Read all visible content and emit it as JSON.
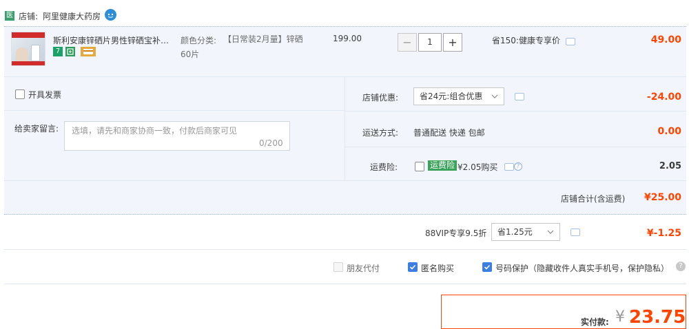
{
  "shop": {
    "badge": "医",
    "prefix": "店铺:",
    "name": "阿里健康大药房",
    "chat_icon": "wangwang-chat-icon"
  },
  "item": {
    "title": "斯利安康锌硒片男性锌硒宝补锌...",
    "tags": [
      "7",
      "credit-badge-icon",
      "wallet-card-icon"
    ],
    "sku_label": "颜色分类:",
    "sku_value_line1": "【日常装2月量】锌硒",
    "sku_value_line2": "60片",
    "unit_price": "199.00",
    "qty_minus": "−",
    "quantity": "1",
    "qty_plus": "+",
    "promo": "省150:健康专享价",
    "subtotal": "49.00"
  },
  "invoice": {
    "label": "开具发票"
  },
  "remark": {
    "label": "给卖家留言:",
    "placeholder": "选填，请先和商家协商一致，付款后商家可见",
    "counter": "0/200"
  },
  "discount": {
    "label": "店铺优惠:",
    "selected": "省24元:组合优惠",
    "amount": "-24.00"
  },
  "shipping": {
    "label": "运送方式:",
    "value": "普通配送 快递 包邮",
    "amount": "0.00"
  },
  "insurance": {
    "label": "运费险:",
    "tag": "运费险",
    "value": "¥2.05购买",
    "amount": "2.05"
  },
  "shop_total": {
    "label": "店铺合计(含运费)",
    "amount": "¥25.00"
  },
  "vip": {
    "label": "88VIP专享9.5折",
    "selected": "省1.25元",
    "amount": "¥-1.25"
  },
  "options": {
    "friend_pay": "朋友代付",
    "anonymous": "匿名购买",
    "number_protect": "号码保护（隐藏收件人真实手机号，保护隐私）"
  },
  "payment": {
    "label": "实付款:",
    "currency": "¥",
    "amount": "23.75"
  },
  "colors": {
    "accent_red": "#ff4400",
    "checkbox_blue": "#3c7ee1",
    "tag_green": "#3aa35a"
  }
}
